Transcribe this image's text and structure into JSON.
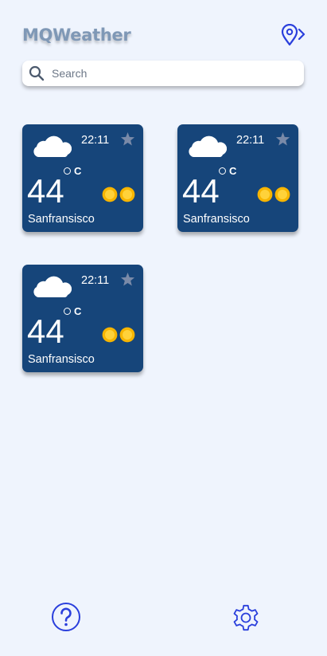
{
  "header": {
    "title": "MQWeather",
    "location_icon": "location-pin-arrow-icon"
  },
  "search": {
    "placeholder": "Search",
    "value": "",
    "icon": "search-icon"
  },
  "cards": [
    {
      "time": "22:11",
      "degree_unit": "C",
      "temperature": "44",
      "city": "Sanfransisco",
      "favorited": false
    },
    {
      "time": "22:11",
      "degree_unit": "C",
      "temperature": "44",
      "city": "Sanfransisco",
      "favorited": false
    },
    {
      "time": "22:11",
      "degree_unit": "C",
      "temperature": "44",
      "city": "Sanfransisco",
      "favorited": false
    }
  ],
  "footer": {
    "help_icon": "question-circle-icon",
    "settings_icon": "gear-icon"
  },
  "colors": {
    "background": "#eff4fd",
    "card": "#16457a",
    "title": "#7f98b6",
    "accent": "#2a3fdc",
    "sun": "#f7b500",
    "star": "#7a8aa8"
  }
}
